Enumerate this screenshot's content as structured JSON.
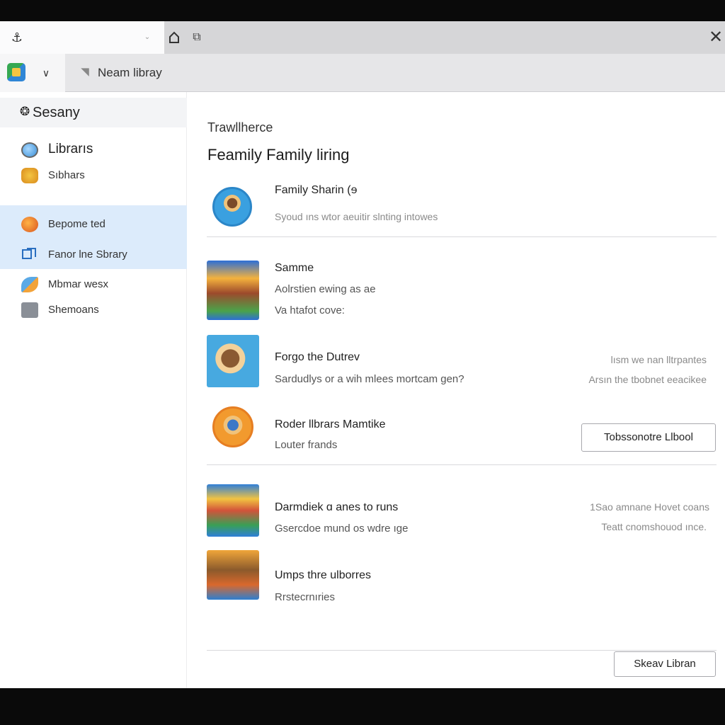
{
  "tabs": {
    "active_logo": "⚓",
    "chevron": "⌄",
    "extension_icon": "⧉",
    "close": "✕"
  },
  "address": {
    "chevron": "∨",
    "pin_icon": "◥",
    "text": "Neam libray"
  },
  "sidebar": {
    "header": {
      "icon": "❂",
      "label": "Sesany"
    },
    "items": [
      {
        "label": "Librarıs"
      },
      {
        "label": "Sıbhars"
      },
      {
        "label": "Bepome ted"
      },
      {
        "label": "Fanor lne Sbrary"
      },
      {
        "label": "Mbmar wesx"
      },
      {
        "label": "Shemoans"
      }
    ]
  },
  "main": {
    "breadcrumb": "Trawllherce",
    "title": "Feamily Family liring",
    "rows": [
      {
        "title": "Family Sharin (ɘ",
        "subtitle": "Syoud ıns wtor aeuitir slnting intowes"
      },
      {
        "title": "Samme",
        "subtitle": "Aolrstien ewing as ae",
        "subtitle2": "Va htafot cove:"
      },
      {
        "title": "Forgo the Dutrev",
        "subtitle": "Sardudlys or a wih mlees mortcam gen?",
        "right1": "lısm we nan lltrpantes",
        "right2": "Arsın the tbobnet eeacikee"
      },
      {
        "title": "Roder llbrars Mamtike",
        "subtitle": "Louter frands",
        "button": "Tobssonotre Llbool"
      },
      {
        "title": "Darmdiek ɑ anes to runs",
        "subtitle": "Gsercdoe mund os wdre ıge",
        "right1": "1Sao amnane Hovet coans",
        "right2": "Teatt cnomshouod ınce."
      },
      {
        "title": "Umps thre ulborres",
        "subtitle": "Rrstecrnıries"
      }
    ],
    "footer_button": "Skeav Libran"
  }
}
